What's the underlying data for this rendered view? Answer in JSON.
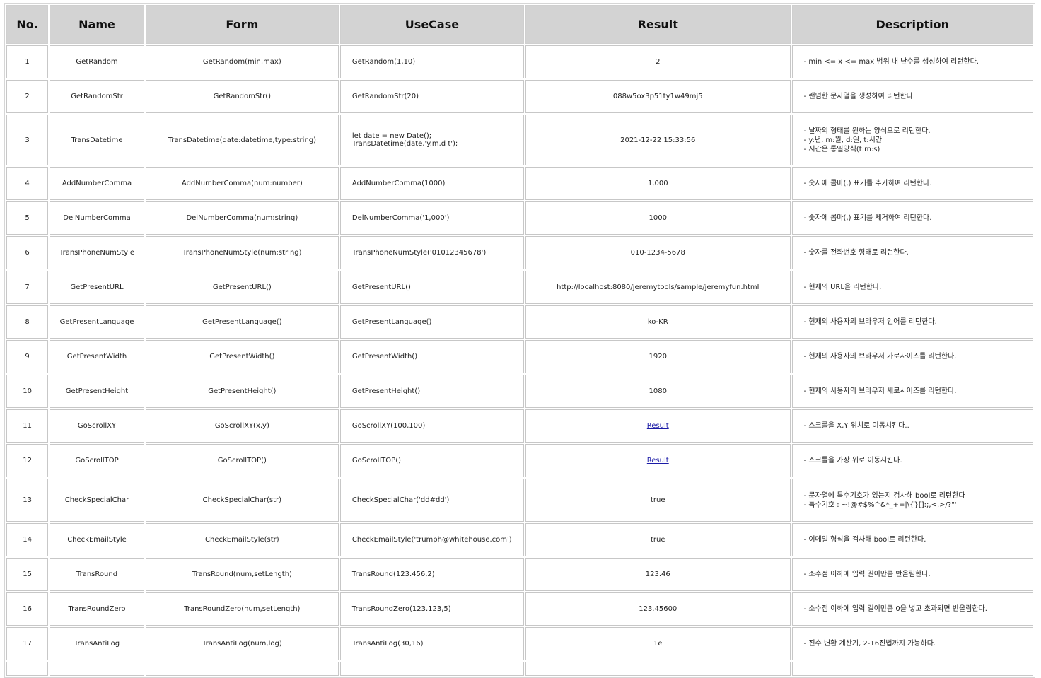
{
  "headers": {
    "no": "No.",
    "name": "Name",
    "form": "Form",
    "usecase": "UseCase",
    "result": "Result",
    "description": "Description"
  },
  "rows": [
    {
      "no": "1",
      "name": "GetRandom",
      "form": "GetRandom(min,max)",
      "usecase": [
        "GetRandom(1,10)"
      ],
      "result": "2",
      "result_link": false,
      "description": [
        "- min <= x <= max 범위 내 난수를 생성하여 리턴한다."
      ]
    },
    {
      "no": "2",
      "name": "GetRandomStr",
      "form": "GetRandomStr()",
      "usecase": [
        "GetRandomStr(20)"
      ],
      "result": "088w5ox3p51ty1w49mj5",
      "result_link": false,
      "description": [
        "- 랜덤한 문자열을 생성하여 리턴한다."
      ]
    },
    {
      "no": "3",
      "name": "TransDatetime",
      "form": "TransDatetime(date:datetime,type:string)",
      "usecase": [
        "let date = new Date();",
        "TransDatetime(date,'y.m.d t');"
      ],
      "result": "2021-12-22 15:33:56",
      "result_link": false,
      "description": [
        "- 날짜의 형태를 원하는 양식으로 리턴한다.",
        "- y:년, m:월, d:일, t:시간",
        "- 시간은 통일양식(t:m:s)"
      ]
    },
    {
      "no": "4",
      "name": "AddNumberComma",
      "form": "AddNumberComma(num:number)",
      "usecase": [
        "AddNumberComma(1000)"
      ],
      "result": "1,000",
      "result_link": false,
      "description": [
        "- 숫자에 콤마(,) 표기를 추가하여 리턴한다."
      ]
    },
    {
      "no": "5",
      "name": "DelNumberComma",
      "form": "DelNumberComma(num:string)",
      "usecase": [
        "DelNumberComma('1,000')"
      ],
      "result": "1000",
      "result_link": false,
      "description": [
        "- 숫자에 콤마(,) 표기를 제거하여 리턴한다."
      ]
    },
    {
      "no": "6",
      "name": "TransPhoneNumStyle",
      "form": "TransPhoneNumStyle(num:string)",
      "usecase": [
        "TransPhoneNumStyle('01012345678')"
      ],
      "result": "010-1234-5678",
      "result_link": false,
      "description": [
        "- 숫자를 전화번호 형태로 리턴한다."
      ]
    },
    {
      "no": "7",
      "name": "GetPresentURL",
      "form": "GetPresentURL()",
      "usecase": [
        "GetPresentURL()"
      ],
      "result": "http://localhost:8080/jeremytools/sample/jeremyfun.html",
      "result_link": false,
      "description": [
        "- 현재의 URL을 리턴한다."
      ]
    },
    {
      "no": "8",
      "name": "GetPresentLanguage",
      "form": "GetPresentLanguage()",
      "usecase": [
        "GetPresentLanguage()"
      ],
      "result": "ko-KR",
      "result_link": false,
      "description": [
        "- 현재의 사용자의 브라우저 언어를 리턴한다."
      ]
    },
    {
      "no": "9",
      "name": "GetPresentWidth",
      "form": "GetPresentWidth()",
      "usecase": [
        "GetPresentWidth()"
      ],
      "result": "1920",
      "result_link": false,
      "description": [
        "- 현재의 사용자의 브라우저 가로사이즈를 리턴한다."
      ]
    },
    {
      "no": "10",
      "name": "GetPresentHeight",
      "form": "GetPresentHeight()",
      "usecase": [
        "GetPresentHeight()"
      ],
      "result": "1080",
      "result_link": false,
      "description": [
        "- 현재의 사용자의 브라우저 세로사이즈를 리턴한다."
      ]
    },
    {
      "no": "11",
      "name": "GoScrollXY",
      "form": "GoScrollXY(x,y)",
      "usecase": [
        "GoScrollXY(100,100)"
      ],
      "result": "Result",
      "result_link": true,
      "description": [
        "- 스크롤을 X,Y 위치로 이동시킨다.."
      ]
    },
    {
      "no": "12",
      "name": "GoScrollTOP",
      "form": "GoScrollTOP()",
      "usecase": [
        "GoScrollTOP()"
      ],
      "result": "Result",
      "result_link": true,
      "description": [
        "- 스크롤을 가장 위로 이동시킨다."
      ]
    },
    {
      "no": "13",
      "name": "CheckSpecialChar",
      "form": "CheckSpecialChar(str)",
      "usecase": [
        "CheckSpecialChar('dd#dd')"
      ],
      "result": "true",
      "result_link": false,
      "description": [
        "- 문자열에 특수기호가 있는지 검사해 bool로 리턴한다",
        "- 특수기호 : ~!@#$%^&*_+=|\\{}[]:;,<.>/?\"'"
      ]
    },
    {
      "no": "14",
      "name": "CheckEmailStyle",
      "form": "CheckEmailStyle(str)",
      "usecase": [
        "CheckEmailStyle('trumph@whitehouse.com')"
      ],
      "result": "true",
      "result_link": false,
      "description": [
        "- 이메일 형식을 검사해 bool로 리턴한다."
      ]
    },
    {
      "no": "15",
      "name": "TransRound",
      "form": "TransRound(num,setLength)",
      "usecase": [
        "TransRound(123.456,2)"
      ],
      "result": "123.46",
      "result_link": false,
      "description": [
        "- 소수점 이하에 입력 길이만큼 반올림한다."
      ]
    },
    {
      "no": "16",
      "name": "TransRoundZero",
      "form": "TransRoundZero(num,setLength)",
      "usecase": [
        "TransRoundZero(123.123,5)"
      ],
      "result": "123.45600",
      "result_link": false,
      "description": [
        "- 소수점 이하에 입력 길이만큼 0을 넣고 초과되면 반올림한다."
      ]
    },
    {
      "no": "17",
      "name": "TransAntiLog",
      "form": "TransAntiLog(num,log)",
      "usecase": [
        "TransAntiLog(30,16)"
      ],
      "result": "1e",
      "result_link": false,
      "description": [
        "- 진수 변환 계산기, 2-16진법까지 가능하다."
      ]
    }
  ]
}
